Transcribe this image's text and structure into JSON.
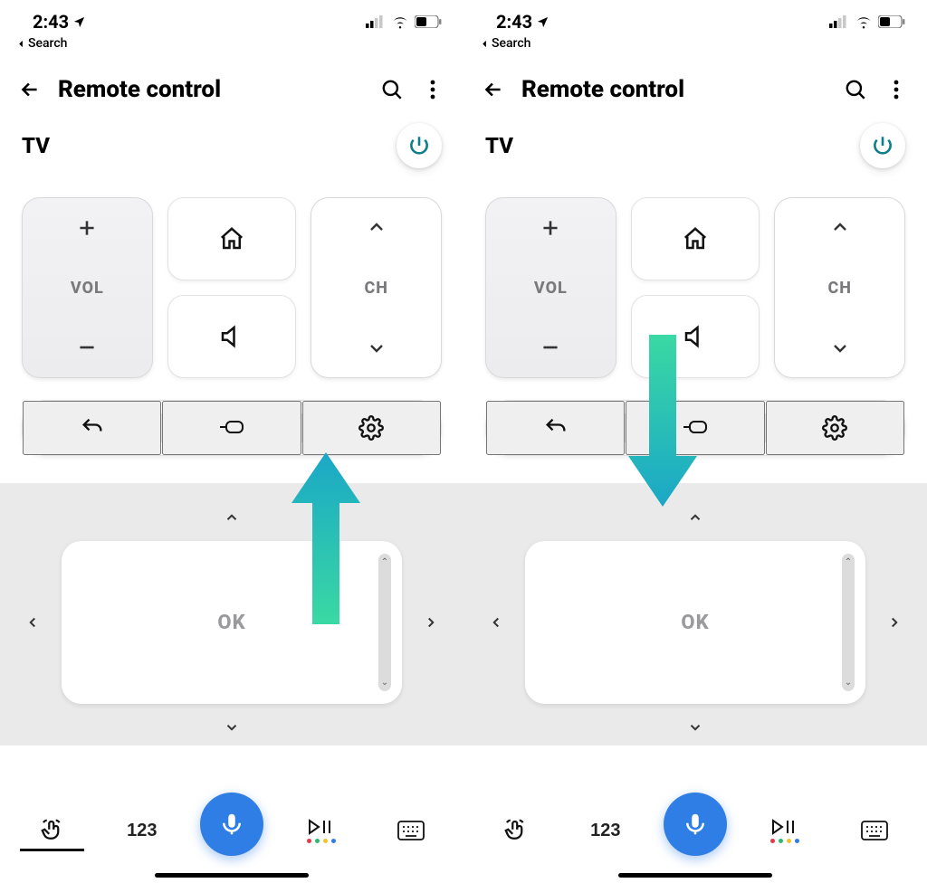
{
  "status": {
    "time": "2:43",
    "back": "Search"
  },
  "header": {
    "title": "Remote control"
  },
  "device": {
    "name": "TV"
  },
  "pad": {
    "vol": "VOL",
    "ch": "CH"
  },
  "dpad": {
    "ok": "OK"
  },
  "tabs": {
    "num": "123"
  },
  "annotation": {
    "left": "up",
    "right": "down"
  }
}
